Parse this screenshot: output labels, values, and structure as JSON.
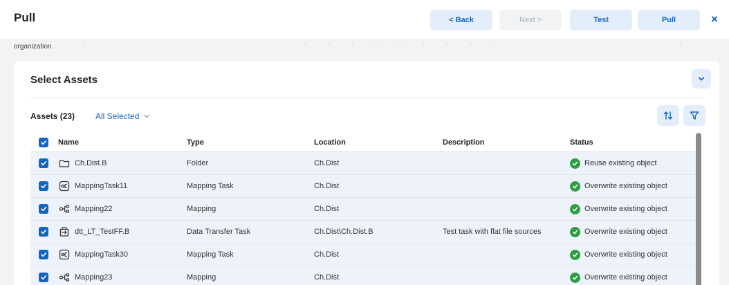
{
  "header": {
    "title": "Pull",
    "back_label": "< Back",
    "next_label": "Next >",
    "test_label": "Test",
    "pull_label": "Pull",
    "close_label": "×"
  },
  "intro": {
    "text": "organization."
  },
  "card": {
    "title": "Select Assets",
    "assets_count": "Assets (23)",
    "selection_label": "All Selected"
  },
  "table": {
    "columns": [
      "Name",
      "Type",
      "Location",
      "Description",
      "Status"
    ],
    "rows": [
      {
        "name": "Ch.Dist.B",
        "icon": "folder-icon",
        "type": "Folder",
        "location": "Ch.Dist",
        "description": "",
        "status": "Reuse existing object"
      },
      {
        "name": "MappingTask11",
        "icon": "mapping-task-icon",
        "type": "Mapping Task",
        "location": "Ch.Dist",
        "description": "",
        "status": "Overwrite existing object"
      },
      {
        "name": "Mapping22",
        "icon": "mapping-icon",
        "type": "Mapping",
        "location": "Ch.Dist",
        "description": "",
        "status": "Overwrite existing object"
      },
      {
        "name": "dtt_LT_TestFF.B",
        "icon": "data-transfer-task-icon",
        "type": "Data Transfer Task",
        "location": "Ch.Dist\\Ch.Dist.B",
        "description": "Test task with flat file sources",
        "status": "Overwrite existing object"
      },
      {
        "name": "MappingTask30",
        "icon": "mapping-task-icon",
        "type": "Mapping Task",
        "location": "Ch.Dist",
        "description": "",
        "status": "Overwrite existing object"
      },
      {
        "name": "Mapping23",
        "icon": "mapping-icon",
        "type": "Mapping",
        "location": "Ch.Dist",
        "description": "",
        "status": "Overwrite existing object"
      }
    ]
  },
  "colors": {
    "accent": "#1565c0",
    "accent_bg": "#e4eefb",
    "success": "#2e9e43",
    "row_bg": "#eef3fb"
  }
}
